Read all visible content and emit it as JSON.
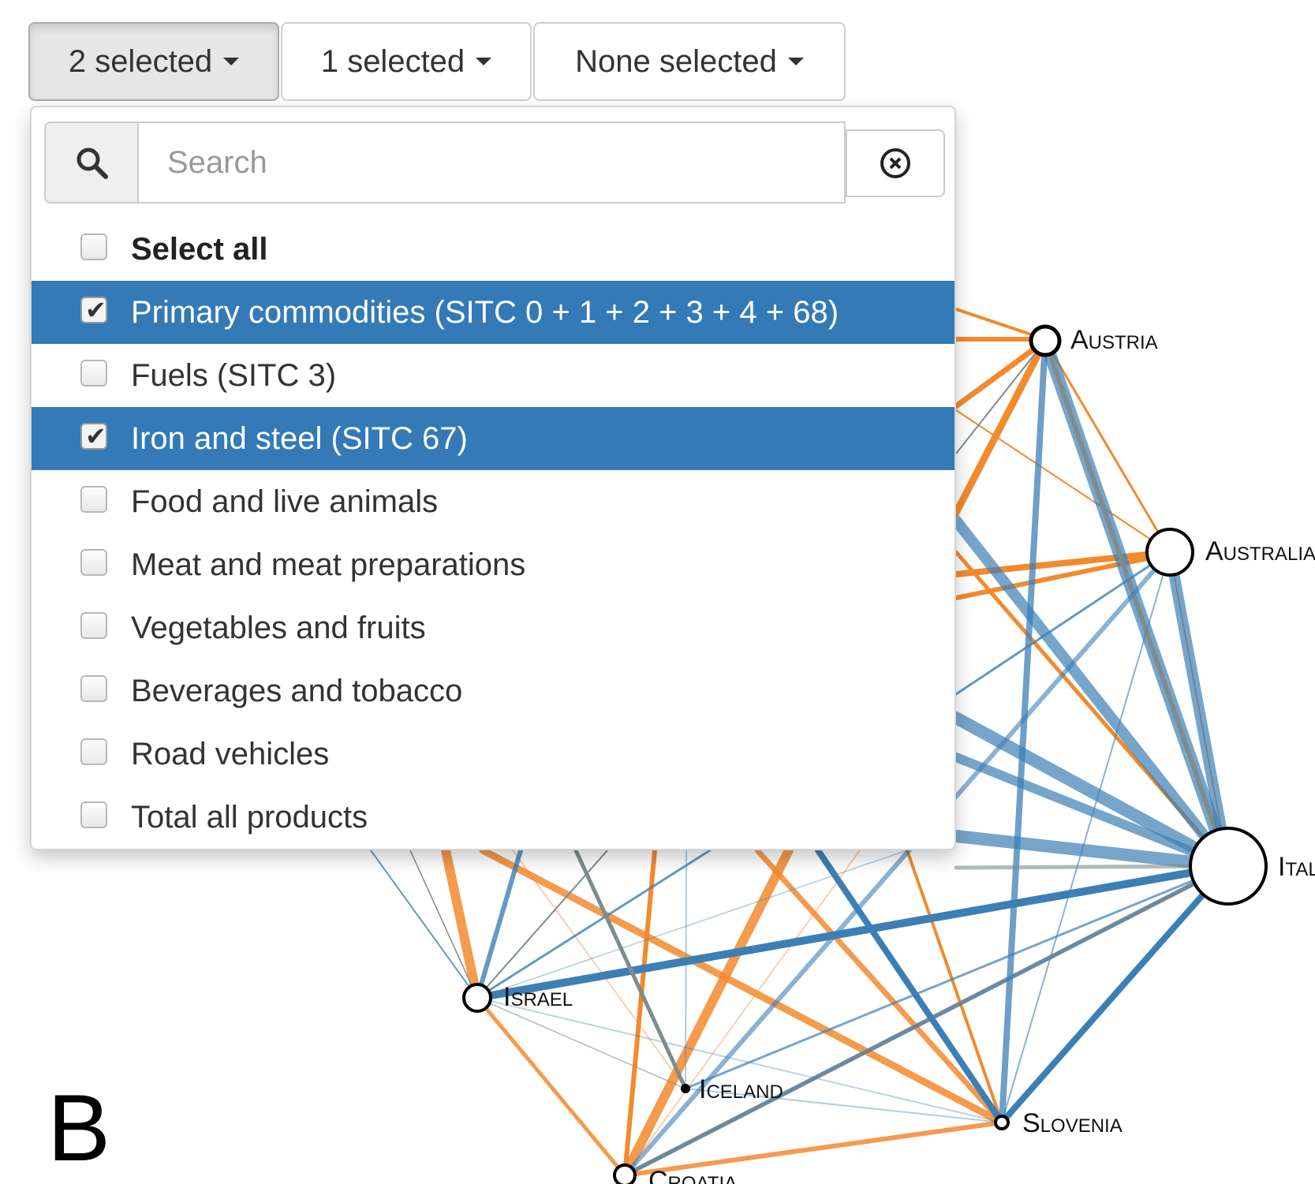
{
  "buttons": {
    "first": "2 selected",
    "second": "1 selected",
    "third": "None selected"
  },
  "dropdown": {
    "search_placeholder": "Search",
    "options": [
      {
        "label": "Select all",
        "checked": false
      },
      {
        "label": "Primary commodities (SITC 0 + 1 + 2 + 3 + 4 + 68)",
        "checked": true
      },
      {
        "label": "Fuels (SITC 3)",
        "checked": false
      },
      {
        "label": "Iron and steel (SITC 67)",
        "checked": true
      },
      {
        "label": "Food and live animals",
        "checked": false
      },
      {
        "label": "Meat and meat preparations",
        "checked": false
      },
      {
        "label": "Vegetables and fruits",
        "checked": false
      },
      {
        "label": "Beverages and tobacco",
        "checked": false
      },
      {
        "label": "Road vehicles",
        "checked": false
      },
      {
        "label": "Total all products",
        "checked": false
      }
    ]
  },
  "network": {
    "nodes": [
      {
        "name": "Austria",
        "label": "Austria"
      },
      {
        "name": "Australia",
        "label": "Australia"
      },
      {
        "name": "Italy",
        "label": "Ital"
      },
      {
        "name": "Israel",
        "label": "Israel"
      },
      {
        "name": "Iceland",
        "label": "Iceland"
      },
      {
        "name": "Slovenia",
        "label": "Slovenia"
      },
      {
        "name": "Croatia",
        "label": "Croatia"
      }
    ],
    "colors": {
      "orange": "#f28a2e",
      "blue": "#3c7fb5",
      "gray": "#7d8c8e"
    }
  },
  "panel_letter": "B"
}
